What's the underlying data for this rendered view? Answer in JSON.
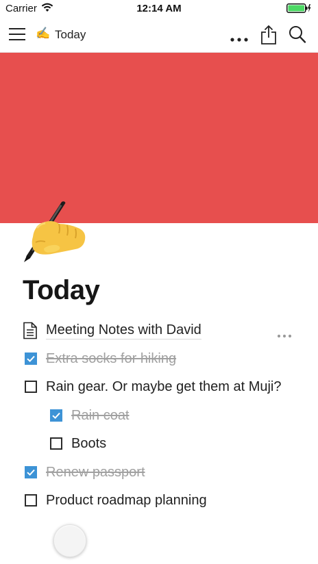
{
  "status_bar": {
    "carrier": "Carrier",
    "time": "12:14 AM",
    "battery_color": "#4cd964"
  },
  "nav": {
    "emoji": "✍️",
    "title": "Today",
    "icons": [
      "menu-icon",
      "more-icon",
      "share-icon",
      "search-icon"
    ]
  },
  "cover": {
    "color": "#e74f4e"
  },
  "page": {
    "icon": "writing-hand",
    "title": "Today"
  },
  "blocks": [
    {
      "type": "page-link",
      "label": "Meeting Notes with David"
    },
    {
      "type": "todo",
      "label": "Extra socks for hiking",
      "checked": true,
      "indent": 0
    },
    {
      "type": "todo",
      "label": "Rain gear. Or maybe get them at Muji?",
      "checked": false,
      "indent": 0
    },
    {
      "type": "todo",
      "label": "Rain coat",
      "checked": true,
      "indent": 1
    },
    {
      "type": "todo",
      "label": "Boots",
      "checked": false,
      "indent": 1
    },
    {
      "type": "todo",
      "label": "Renew passport",
      "checked": true,
      "indent": 0
    },
    {
      "type": "todo",
      "label": "Product roadmap planning",
      "checked": false,
      "indent": 0
    }
  ],
  "colors": {
    "checkbox_checked": "#3d93d6",
    "done_text": "#a0a0a0"
  }
}
